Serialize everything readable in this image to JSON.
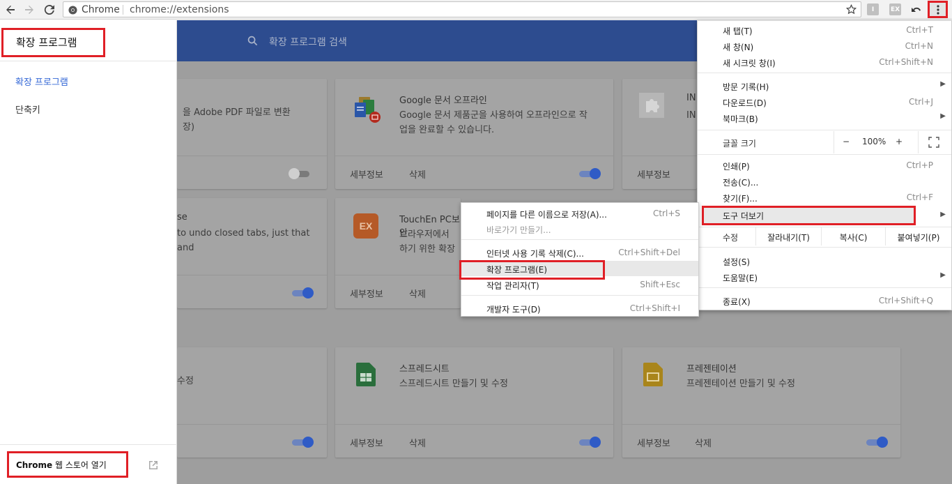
{
  "browser": {
    "tab_chip": "Chrome",
    "url": "chrome://extensions",
    "toolbar_ext_1": "I",
    "toolbar_ext_2": "EX"
  },
  "drawer": {
    "title": "확장 프로그램",
    "items": [
      {
        "label": "확장 프로그램",
        "active": true
      },
      {
        "label": "단축키",
        "active": false
      }
    ],
    "store_bold": "Chrome",
    "store_rest": " 웹 스토어 열기"
  },
  "search": {
    "placeholder": "확장 프로그램 검색"
  },
  "cards": {
    "details": "세부정보",
    "remove": "삭제",
    "c1_desc1": "을 Adobe PDF 파일로 변환",
    "c1_desc2": "장)",
    "c2_title": "Google 문서 오프라인",
    "c2_desc1": "Google 문서 제품군을 사용하여 오프라인으로 작",
    "c2_desc2": "업을 완료할 수 있습니다.",
    "c3_title": "IN",
    "c3_desc": "IN",
    "c4_title": "se",
    "c4_desc": "to undo closed tabs, just that and",
    "c5_title": "TouchEn PC보안",
    "c5_desc1": "브라우저에서 ",
    "c5_desc2": "하기 위한 확장",
    "c5_icon": "EX",
    "c7_desc": "수정",
    "c8_title": "스프레드시트",
    "c8_desc": "스프레드시트 만들기 및 수정",
    "c9_title": "프레젠테이션",
    "c9_desc": "프레젠테이션 만들기 및 수정",
    "toggles_on": [
      false,
      true,
      true,
      true,
      true,
      true,
      true
    ]
  },
  "main_menu": {
    "new_tab": {
      "label": "새 탭(T)",
      "shortcut": "Ctrl+T"
    },
    "new_window": {
      "label": "새 창(N)",
      "shortcut": "Ctrl+N"
    },
    "incognito": {
      "label": "새 시크릿 창(I)",
      "shortcut": "Ctrl+Shift+N"
    },
    "history": {
      "label": "방문 기록(H)"
    },
    "downloads": {
      "label": "다운로드(D)",
      "shortcut": "Ctrl+J"
    },
    "bookmarks": {
      "label": "북마크(B)"
    },
    "zoom": {
      "label": "글꼴 크기",
      "minus": "−",
      "value": "100%",
      "plus": "+"
    },
    "print": {
      "label": "인쇄(P)",
      "shortcut": "Ctrl+P"
    },
    "cast": {
      "label": "전송(C)..."
    },
    "find": {
      "label": "찾기(F)...",
      "shortcut": "Ctrl+F"
    },
    "more_tools": {
      "label": "도구 더보기"
    },
    "edit": {
      "label": "수정",
      "cut": "잘라내기(T)",
      "copy": "복사(C)",
      "paste": "붙여넣기(P)"
    },
    "settings": {
      "label": "설정(S)"
    },
    "help": {
      "label": "도움말(E)"
    },
    "exit": {
      "label": "종료(X)",
      "shortcut": "Ctrl+Shift+Q"
    }
  },
  "sub_menu": {
    "save_as": {
      "label": "페이지를 다른 이름으로 저장(A)...",
      "shortcut": "Ctrl+S"
    },
    "shortcut": {
      "label": "바로가기 만들기..."
    },
    "clear": {
      "label": "인터넷 사용 기록 삭제(C)...",
      "shortcut": "Ctrl+Shift+Del"
    },
    "extensions": {
      "label": "확장 프로그램(E)"
    },
    "task_manager": {
      "label": "작업 관리자(T)",
      "shortcut": "Shift+Esc"
    },
    "devtools": {
      "label": "개발자 도구(D)",
      "shortcut": "Ctrl+Shift+I"
    }
  },
  "colors": {
    "highlight": "#e01f26",
    "accent": "#2f5bc6",
    "header": "#2d4c8f"
  }
}
